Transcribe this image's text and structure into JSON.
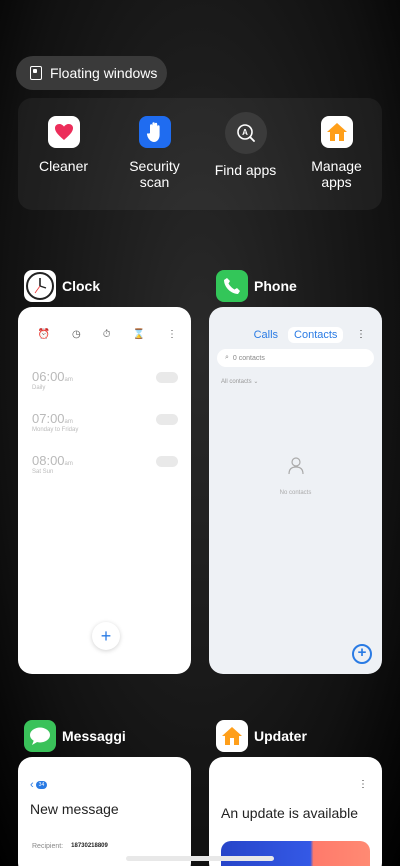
{
  "floating_windows": {
    "label": "Floating windows"
  },
  "quick_actions": [
    {
      "id": "cleaner",
      "label": "Cleaner",
      "icon": "heart-icon"
    },
    {
      "id": "security",
      "label": "Security scan",
      "icon": "hand-shield-icon"
    },
    {
      "id": "find",
      "label": "Find apps",
      "icon": "search-apps-icon"
    },
    {
      "id": "manage",
      "label": "Manage apps",
      "icon": "house-icon"
    }
  ],
  "apps": {
    "clock": {
      "name": "Clock",
      "alarms": [
        {
          "time": "06:00",
          "ampm": "am",
          "sub": "Daily"
        },
        {
          "time": "07:00",
          "ampm": "am",
          "sub": "Monday to Friday"
        },
        {
          "time": "08:00",
          "ampm": "am",
          "sub": "Sat Sun"
        }
      ],
      "add": "+"
    },
    "phone": {
      "name": "Phone",
      "tabs": [
        "Calls",
        "Contacts"
      ],
      "search_placeholder": "0 contacts",
      "all_contacts": "All contacts",
      "empty": "No contacts",
      "add": "+"
    },
    "messages": {
      "name": "Messaggi",
      "back_badge": "34",
      "title": "New message",
      "recipient_label": "Recipient:",
      "recipient_number": "18730218809"
    },
    "updater": {
      "name": "Updater",
      "title": "An update is available"
    }
  },
  "colors": {
    "accent": "#2a7be4",
    "phone_green": "#33c659",
    "msg_green": "#3ac25a",
    "orange": "#ff9f1a"
  }
}
